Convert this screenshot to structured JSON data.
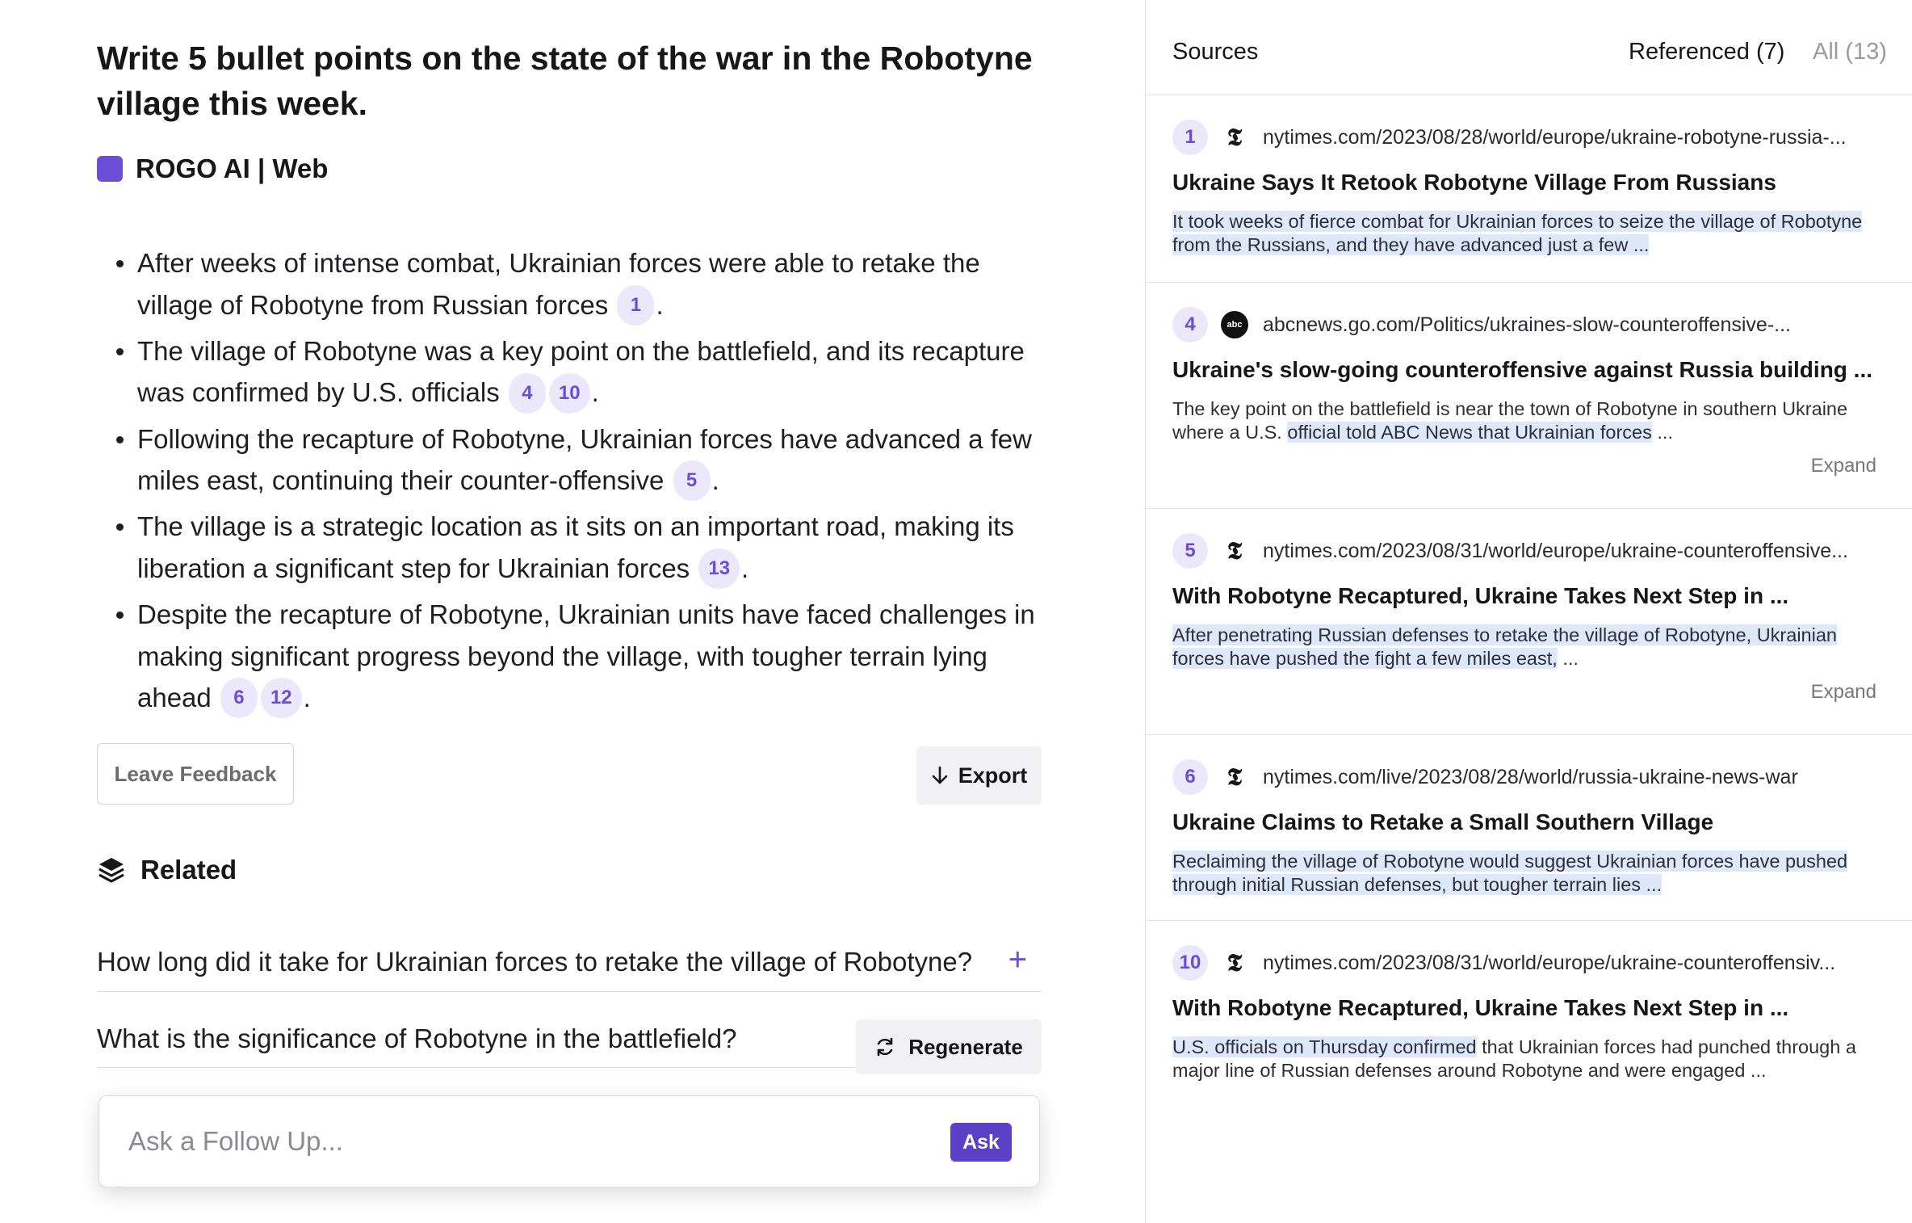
{
  "question": "Write 5 bullet points on the state of the war in the Robotyne village this week.",
  "engine": {
    "label": "ROGO AI | Web",
    "color": "#6a4fd6"
  },
  "answer_bullets": [
    {
      "text": "After weeks of intense combat, Ukrainian forces were able to retake the village of Robotyne from Russian forces",
      "citations": [
        "1"
      ]
    },
    {
      "text": "The village of Robotyne was a key point on the battlefield, and its recapture was confirmed by U.S. officials",
      "citations": [
        "4",
        "10"
      ]
    },
    {
      "text": "Following the recapture of Robotyne, Ukrainian forces have advanced a few miles east, continuing their counter-offensive",
      "citations": [
        "5"
      ]
    },
    {
      "text": "The village is a strategic location as it sits on an important road, making its liberation a significant step for Ukrainian forces",
      "citations": [
        "13"
      ]
    },
    {
      "text": "Despite the recapture of Robotyne, Ukrainian units have faced challenges in making significant progress beyond the village, with tougher terrain lying ahead",
      "citations": [
        "6",
        "12"
      ]
    }
  ],
  "actions": {
    "feedback_label": "Leave Feedback",
    "export_label": "Export",
    "regenerate_label": "Regenerate"
  },
  "related": {
    "title": "Related",
    "items": [
      {
        "text": "How long did it take for Ukrainian forces to retake the village of Robotyne?"
      },
      {
        "text": "What is the significance of Robotyne in the battlefield?"
      }
    ]
  },
  "followup": {
    "placeholder": "Ask a Follow Up...",
    "ask_label": "Ask"
  },
  "sources_panel": {
    "title": "Sources",
    "tab_referenced": "Referenced (7)",
    "tab_all": "All (13)",
    "expand_label": "Expand",
    "items": [
      {
        "num": "1",
        "logo": "nyt-logo-icon",
        "url": "nytimes.com/2023/08/28/world/europe/ukraine-robotyne-russia-...",
        "title": "Ukraine Says It Retook Robotyne Village From Russians",
        "snippet_highlight": "It took weeks of fierce combat for Ukrainian forces to seize the village of Robotyne from the Russians, and they have advanced just a few ...",
        "snippet_rest": ""
      },
      {
        "num": "4",
        "logo": "abc-logo-icon",
        "url": "abcnews.go.com/Politics/ukraines-slow-counteroffensive-...",
        "title": "Ukraine's slow-going counteroffensive against Russia building ...",
        "snippet_plain": "The key point on the battlefield is near the town of Robotyne in southern Ukraine where a U.S. ",
        "snippet_highlight": "official told ABC News that Ukrainian forces",
        "snippet_rest": " ..."
      },
      {
        "num": "5",
        "logo": "nyt-logo-icon",
        "url": "nytimes.com/2023/08/31/world/europe/ukraine-counteroffensive...",
        "title": "With Robotyne Recaptured, Ukraine Takes Next Step in ...",
        "snippet_highlight": "After penetrating Russian defenses to retake the village of Robotyne, Ukrainian forces have pushed the fight a few miles east,",
        "snippet_rest": " ..."
      },
      {
        "num": "6",
        "logo": "nyt-logo-icon",
        "url": "nytimes.com/live/2023/08/28/world/russia-ukraine-news-war",
        "title": "Ukraine Claims to Retake a Small Southern Village",
        "snippet_highlight": "Reclaiming the village of Robotyne would suggest Ukrainian forces have pushed through initial Russian defenses, but tougher terrain lies ...",
        "snippet_rest": ""
      },
      {
        "num": "10",
        "logo": "nyt-logo-icon",
        "url": "nytimes.com/2023/08/31/world/europe/ukraine-counteroffensiv...",
        "title": "With Robotyne Recaptured, Ukraine Takes Next Step in ...",
        "snippet_highlight": "U.S. officials on Thursday confirmed",
        "snippet_rest": " that Ukrainian forces had punched through a major line of Russian defenses around Robotyne and were engaged ..."
      }
    ]
  }
}
